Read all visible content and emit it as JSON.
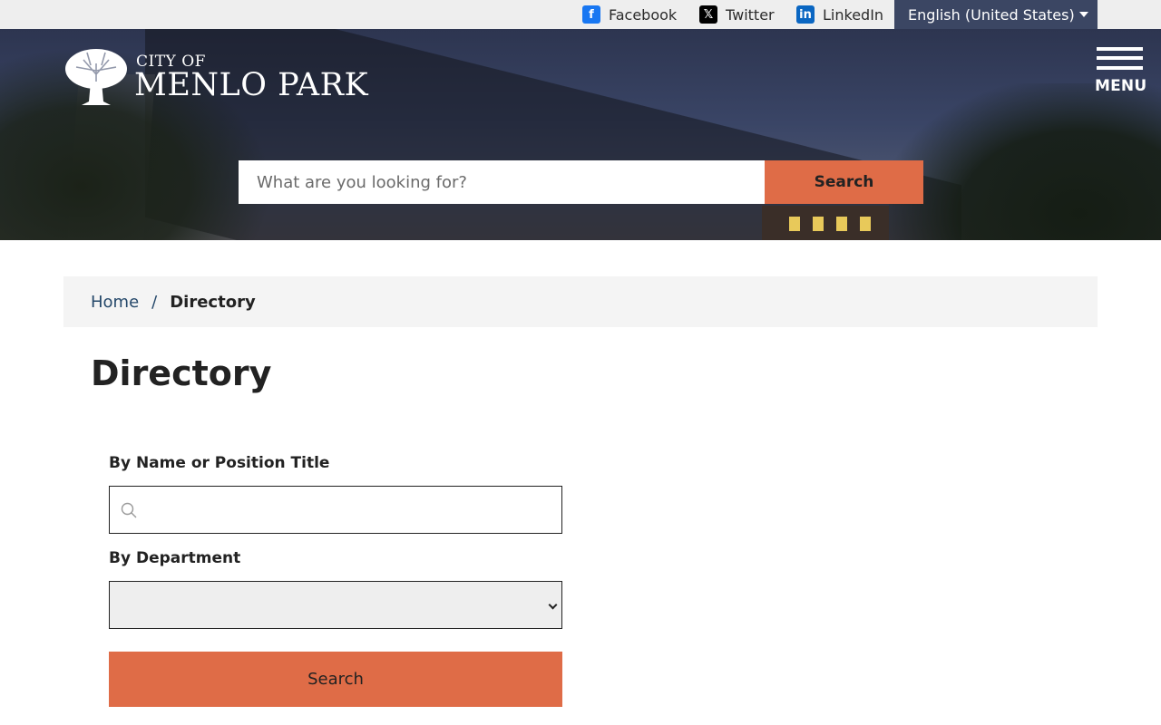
{
  "topbar": {
    "social": [
      {
        "label": "Facebook",
        "icon": "facebook-icon",
        "color": "#1877f2"
      },
      {
        "label": "Twitter",
        "icon": "x-icon",
        "color": "#000000"
      },
      {
        "label": "LinkedIn",
        "icon": "linkedin-icon",
        "color": "#0a66c2"
      }
    ],
    "language": "English (United States)"
  },
  "header": {
    "logo_small": "CITY OF",
    "logo_big": "MENLO PARK",
    "menu_label": "MENU",
    "search_placeholder": "What are you looking for?",
    "search_button": "Search"
  },
  "breadcrumb": {
    "home": "Home",
    "separator": "/",
    "current": "Directory"
  },
  "page": {
    "title": "Directory"
  },
  "form": {
    "name_label": "By Name or Position Title",
    "name_value": "",
    "department_label": "By Department",
    "department_value": "",
    "submit_label": "Search"
  },
  "colors": {
    "accent": "#df6c47",
    "language_bg": "#3b4663",
    "topbar_bg": "#eeeeee",
    "breadcrumb_bg": "#f4f4f4",
    "link": "#25486a"
  }
}
